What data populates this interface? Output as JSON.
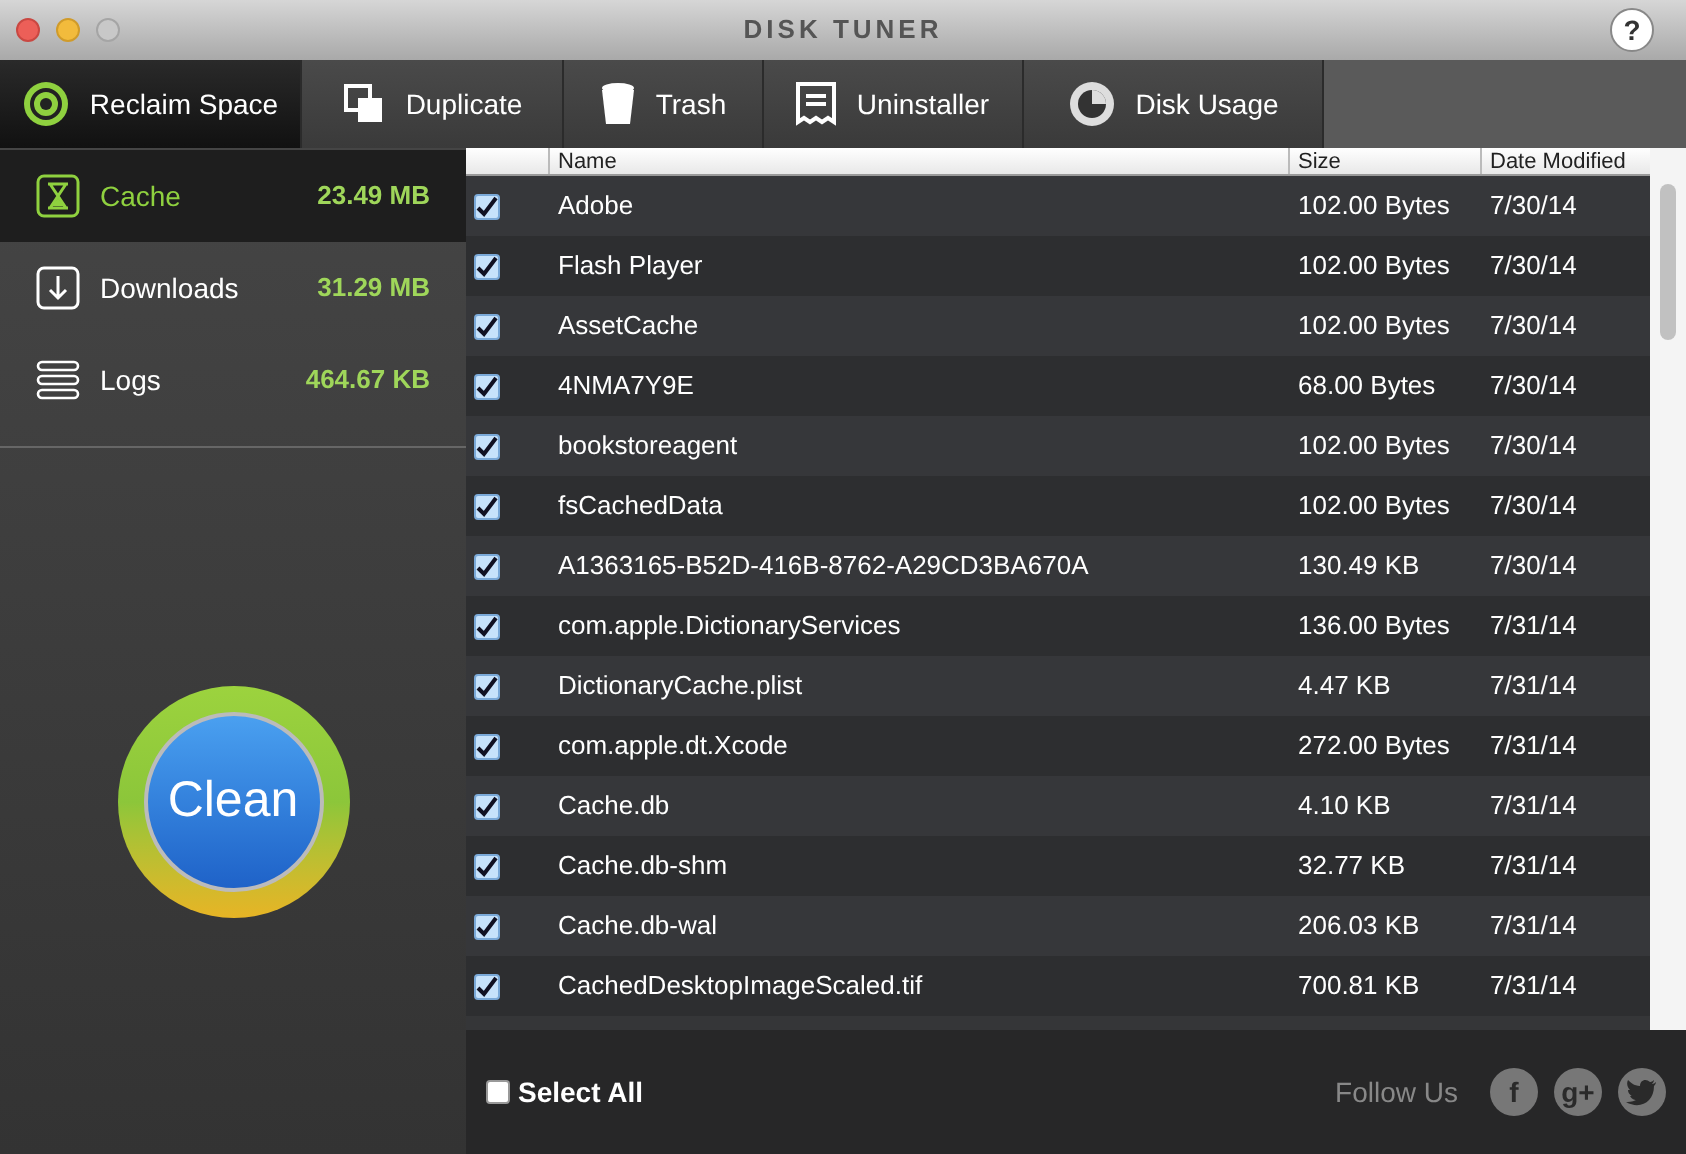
{
  "window": {
    "title": "DISK TUNER",
    "help": "?"
  },
  "tabs": [
    {
      "label": "Reclaim Space",
      "kind": "reclaim",
      "selected": true
    },
    {
      "label": "Duplicate",
      "kind": "duplicate",
      "selected": false
    },
    {
      "label": "Trash",
      "kind": "trash",
      "selected": false
    },
    {
      "label": "Uninstaller",
      "kind": "uninstaller",
      "selected": false
    },
    {
      "label": "Disk Usage",
      "kind": "usage",
      "selected": false
    }
  ],
  "sidebar": {
    "items": [
      {
        "label": "Cache",
        "size": "23.49 MB",
        "kind": "cache",
        "selected": true
      },
      {
        "label": "Downloads",
        "size": "31.29 MB",
        "kind": "downloads",
        "selected": false
      },
      {
        "label": "Logs",
        "size": "464.67 KB",
        "kind": "logs",
        "selected": false
      }
    ],
    "clean_button": "Clean"
  },
  "table": {
    "columns": [
      "Name",
      "Size",
      "Date Modified"
    ],
    "rows": [
      {
        "name": "Adobe",
        "size": "102.00 Bytes",
        "date": "7/30/14",
        "checked": true
      },
      {
        "name": "Flash Player",
        "size": "102.00 Bytes",
        "date": "7/30/14",
        "checked": true
      },
      {
        "name": "AssetCache",
        "size": "102.00 Bytes",
        "date": "7/30/14",
        "checked": true
      },
      {
        "name": "4NMA7Y9E",
        "size": "68.00 Bytes",
        "date": "7/30/14",
        "checked": true
      },
      {
        "name": "bookstoreagent",
        "size": "102.00 Bytes",
        "date": "7/30/14",
        "checked": true
      },
      {
        "name": "fsCachedData",
        "size": "102.00 Bytes",
        "date": "7/30/14",
        "checked": true
      },
      {
        "name": "A1363165-B52D-416B-8762-A29CD3BA670A",
        "size": "130.49 KB",
        "date": "7/30/14",
        "checked": true
      },
      {
        "name": "com.apple.DictionaryServices",
        "size": "136.00 Bytes",
        "date": "7/31/14",
        "checked": true
      },
      {
        "name": "DictionaryCache.plist",
        "size": "4.47 KB",
        "date": "7/31/14",
        "checked": true
      },
      {
        "name": "com.apple.dt.Xcode",
        "size": "272.00 Bytes",
        "date": "7/31/14",
        "checked": true
      },
      {
        "name": "Cache.db",
        "size": "4.10 KB",
        "date": "7/31/14",
        "checked": true
      },
      {
        "name": "Cache.db-shm",
        "size": "32.77 KB",
        "date": "7/31/14",
        "checked": true
      },
      {
        "name": "Cache.db-wal",
        "size": "206.03 KB",
        "date": "7/31/14",
        "checked": true
      },
      {
        "name": "CachedDesktopImageScaled.tif",
        "size": "700.81 KB",
        "date": "7/31/14",
        "checked": true
      }
    ]
  },
  "footer": {
    "select_all": {
      "label": "Select All",
      "checked": false
    },
    "follow_label": "Follow Us",
    "social": [
      "f",
      "g+"
    ]
  }
}
